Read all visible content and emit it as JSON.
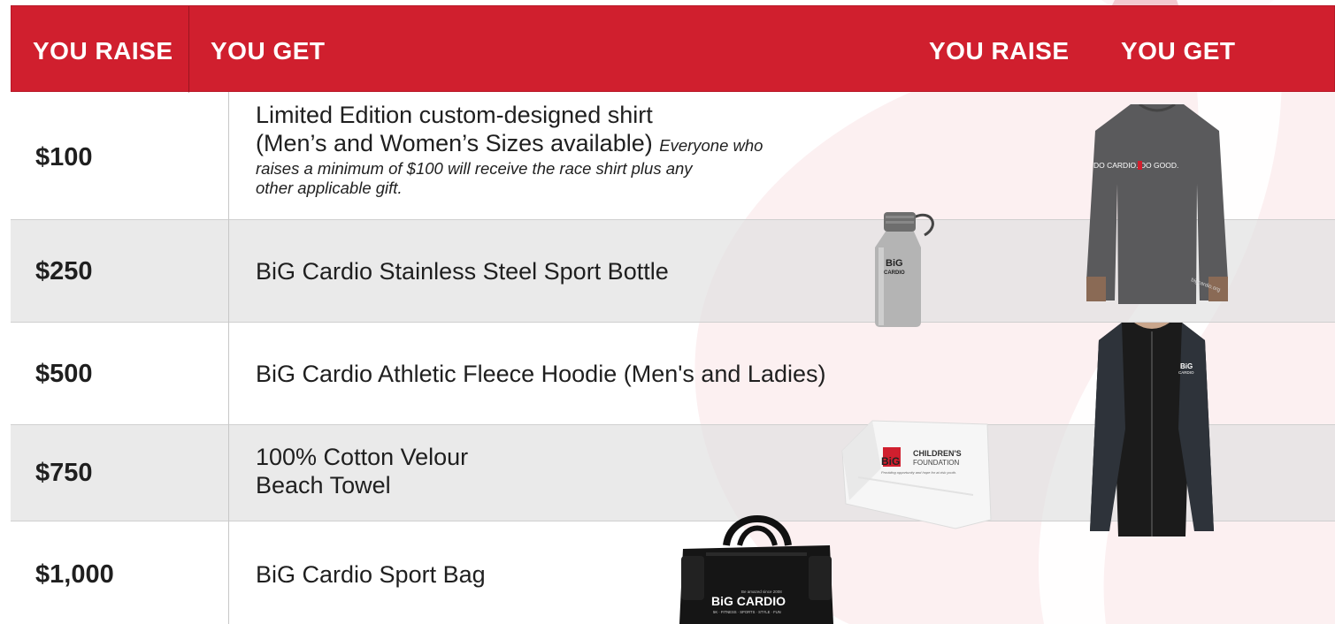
{
  "header": {
    "col_raise_1": "YOU RAISE",
    "col_get_1": "YOU GET",
    "col_raise_2": "YOU RAISE",
    "col_get_2": "YOU GET"
  },
  "rows": [
    {
      "amount": "$100",
      "line1": "Limited Edition custom-designed shirt",
      "line2": "(Men’s and Women’s Sizes available)",
      "note_a": "Everyone who",
      "note_b": "raises a minimum of $100 will receive the race shirt plus any",
      "note_c": "other applicable gift."
    },
    {
      "amount": "$250",
      "line1": "BiG Cardio Stainless Steel Sport Bottle"
    },
    {
      "amount": "$500",
      "line1": "BiG Cardio Athletic Fleece Hoodie (Men's and Ladies)"
    },
    {
      "amount": "$750",
      "line1": "100% Cotton  Velour",
      "line2": "Beach Towel"
    },
    {
      "amount": "$1,000",
      "line1": "BiG Cardio Sport Bag"
    }
  ],
  "product_images": {
    "shirt_print": "DO CARDIO. DO GOOD.",
    "shirt_sleeve": "bigcardio.org",
    "bottle_logo": "BiG",
    "bottle_logo_sub": "CARDIO",
    "hoodie_logo": "BiG",
    "hoodie_logo_sub": "CARDIO",
    "towel_logo": "BiG",
    "towel_title": "CHILDREN'S",
    "towel_subtitle": "FOUNDATION",
    "towel_tagline": "Providing opportunity and hope for at-risk youth.",
    "bag_logo": "BiG CARDIO",
    "bag_tagline_top": "Be amazed since 2008",
    "bag_tagline": "5K · FITNESS · SPORTS · STYLE · FUN"
  },
  "colors": {
    "header_red": "#d01f2e",
    "row_alt_grey": "#e6e6e6",
    "swoosh_pink": "#f6d7dc"
  }
}
